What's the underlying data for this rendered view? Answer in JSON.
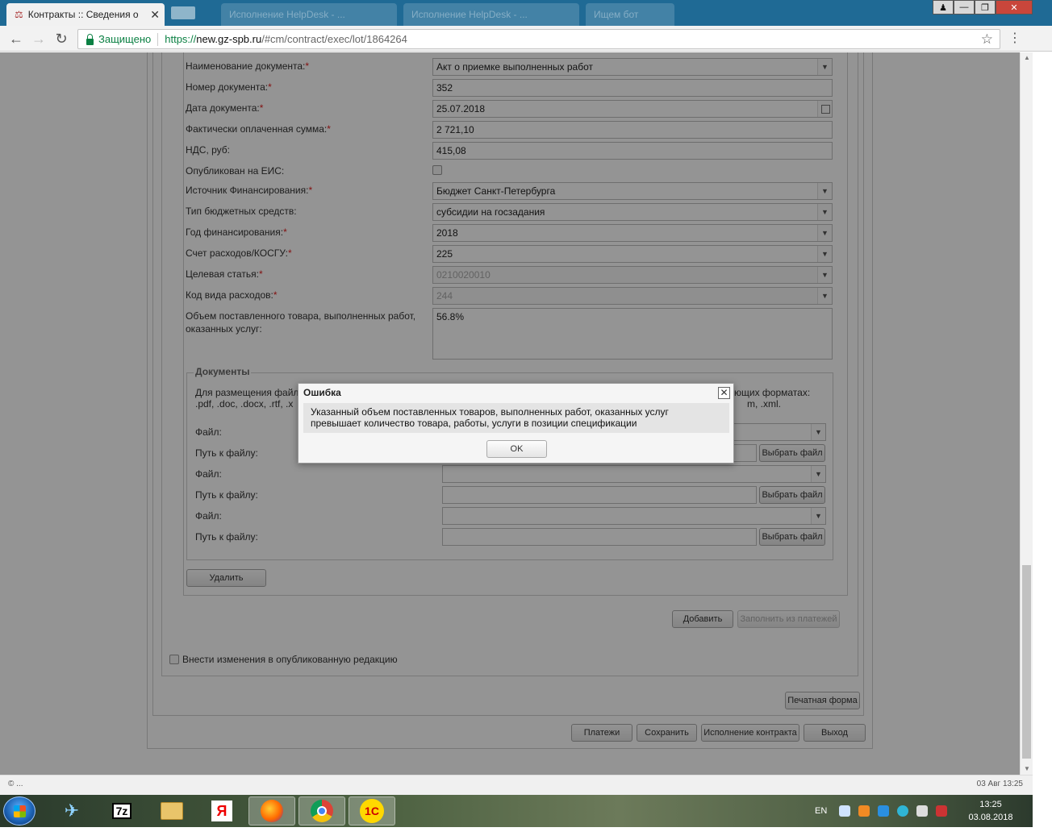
{
  "browser": {
    "active_tab_title": "Контракты :: Сведения о",
    "background_tabs": [
      "Исполнение HelpDesk - ...",
      "Исполнение HelpDesk - ...",
      "Ищем бот"
    ],
    "secure_label": "Защищено",
    "url_scheme": "https://",
    "url_host": "new.gz-spb.ru",
    "url_path": "/#cm/contract/exec/lot/1864264"
  },
  "form": {
    "doc_name_label": "Наименование документа:",
    "doc_name_value": "Акт о приемке выполненных работ",
    "doc_number_label": "Номер документа:",
    "doc_number_value": "352",
    "doc_date_label": "Дата документа:",
    "doc_date_value": "25.07.2018",
    "paid_sum_label": "Фактически оплаченная сумма:",
    "paid_sum_value": "2 721,10",
    "vat_label": "НДС, руб:",
    "vat_value": "415,08",
    "published_label": "Опубликован на ЕИС:",
    "funding_source_label": "Источник Финансирования:",
    "funding_source_value": "Бюджет Санкт-Петербурга",
    "budget_type_label": "Тип бюджетных средств:",
    "budget_type_value": "субсидии на госзадания",
    "funding_year_label": "Год финансирования:",
    "funding_year_value": "2018",
    "kosgu_label": "Счет расходов/КОСГУ:",
    "kosgu_value": "225",
    "target_item_label": "Целевая статья:",
    "target_item_value": "0210020010",
    "expense_code_label": "Код вида расходов:",
    "expense_code_value": "244",
    "volume_label": "Объем поставленного товара, выполненных работ, оказанных услуг:",
    "volume_value": "56.8%",
    "required_mark": "*"
  },
  "documents": {
    "legend": "Документы",
    "hint": "Для размещения файл",
    "hint_line2": ".pdf, .doc, .docx, .rtf, .x",
    "hint_end_line1": "ующих форматах:",
    "hint_end_line2": "m, .xml.",
    "file_label": "Файл:",
    "path_label": "Путь к файлу:",
    "choose_file_btn": "Выбрать файл",
    "delete_btn": "Удалить"
  },
  "actions": {
    "add_btn": "Добавить",
    "fill_from_payments_btn": "Заполнить из платежей",
    "make_changes_label": "Внести изменения в опубликованную редакцию",
    "print_form_btn": "Печатная форма",
    "payments_btn": "Платежи",
    "save_btn": "Сохранить",
    "contract_exec_btn": "Исполнение контракта",
    "exit_btn": "Выход"
  },
  "dialog": {
    "title": "Ошибка",
    "message": "Указанный объем поставленных товаров, выполненных работ, оказанных услуг превышает количество товара, работы, услуги в позиции спецификации",
    "ok_btn": "OK"
  },
  "status": {
    "left": "© ...",
    "right": "03 Авг 13:25"
  },
  "taskbar": {
    "lang": "EN",
    "time": "13:25",
    "date": "03.08.2018",
    "app_7z": "7z",
    "app_yandex": "Я",
    "app_1c": "1С"
  }
}
